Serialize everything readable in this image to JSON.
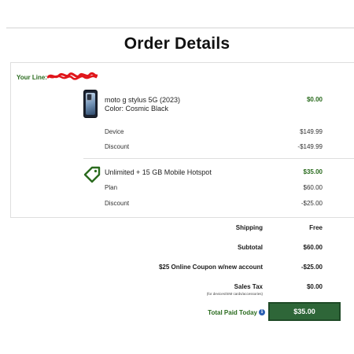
{
  "page": {
    "title": "Order Details"
  },
  "line": {
    "label": "Your Line:"
  },
  "device": {
    "name": "moto g stylus 5G (2023)",
    "color": "Color: Cosmic Black",
    "price": "$0.00",
    "rows": [
      {
        "label": "Device",
        "value": "$149.99"
      },
      {
        "label": "Discount",
        "value": "-$149.99"
      }
    ]
  },
  "plan": {
    "name": "Unlimited + 15 GB Mobile Hotspot",
    "price": "$35.00",
    "rows": [
      {
        "label": "Plan",
        "value": "$60.00"
      },
      {
        "label": "Discount",
        "value": "-$25.00"
      }
    ]
  },
  "summary": {
    "shipping_label": "Shipping",
    "shipping_value": "Free",
    "subtotal_label": "Subtotal",
    "subtotal_value": "$60.00",
    "coupon_label": "$25 Online Coupon w/new account",
    "coupon_value": "-$25.00",
    "tax_label": "Sales Tax",
    "tax_value": "$0.00",
    "tax_note": "(for devices/SIM cards/accessories)",
    "total_label": "Total Paid Today",
    "total_value": "$35.00"
  },
  "colors": {
    "brand_green": "#2a6b1e",
    "total_box": "#2e6638",
    "redaction": "#e0161b",
    "info_blue": "#2c5fb3"
  },
  "icons": [
    "phone-image",
    "price-tag-icon",
    "info-icon"
  ]
}
